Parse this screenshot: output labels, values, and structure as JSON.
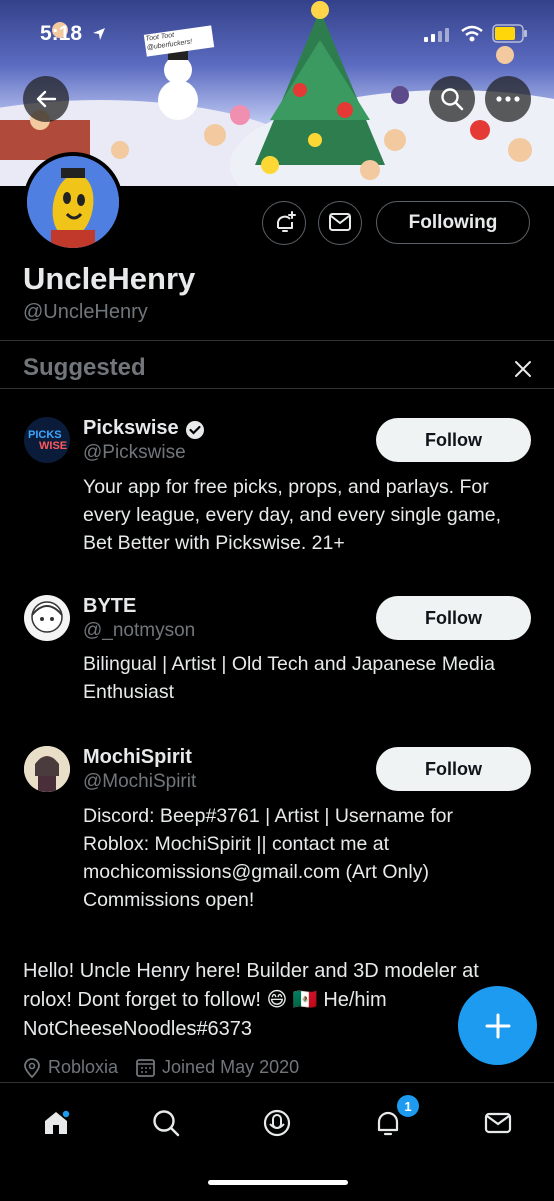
{
  "status_bar": {
    "time": "5:18"
  },
  "banner": {
    "sign_text": "Toot Toot @uberfuckers!"
  },
  "profile": {
    "name": "UncleHenry",
    "handle": "@UncleHenry",
    "following_label": "Following",
    "bio_line1": "Hello! Uncle Henry here! Builder and 3D modeler at",
    "bio_line2": "rolox! Dont forget to follow! 😄 🇲🇽  He/him",
    "bio_line3": "NotCheeseNoodles#6373",
    "location": "Robloxia",
    "joined": "Joined May 2020"
  },
  "suggested": {
    "title": "Suggested",
    "items": [
      {
        "name": "Pickswise",
        "handle": "@Pickswise",
        "verified": true,
        "logo_text_1": "PICKS",
        "logo_text_2": "WISE",
        "bio_line1": "Your app for free picks, props, and parlays. For",
        "bio_line2": "every league, every day, and every single game,",
        "bio_line3": "Bet Better with Pickswise. 21+",
        "follow_label": "Follow"
      },
      {
        "name": "BYTE",
        "handle": "@_notmyson",
        "verified": false,
        "bio_line1": "Bilingual | Artist | Old Tech and Japanese Media",
        "bio_line2": "Enthusiast",
        "follow_label": "Follow"
      },
      {
        "name": "MochiSpirit",
        "handle": "@MochiSpirit",
        "verified": false,
        "bio_line1": "Discord: Beep#3761 | Artist | Username for",
        "bio_line2": "Roblox: MochiSpirit || contact me at",
        "bio_line3": "mochicomissions@gmail.com (Art Only)",
        "bio_line4": "Commissions open!",
        "follow_label": "Follow"
      }
    ]
  },
  "tabbar": {
    "icons": [
      "home-icon",
      "search-icon",
      "spaces-icon",
      "notifications-icon",
      "messages-icon"
    ],
    "notification_count": "1"
  },
  "colors": {
    "accent": "#1d9bf0",
    "background": "#000000",
    "secondary_text": "#71767b"
  }
}
